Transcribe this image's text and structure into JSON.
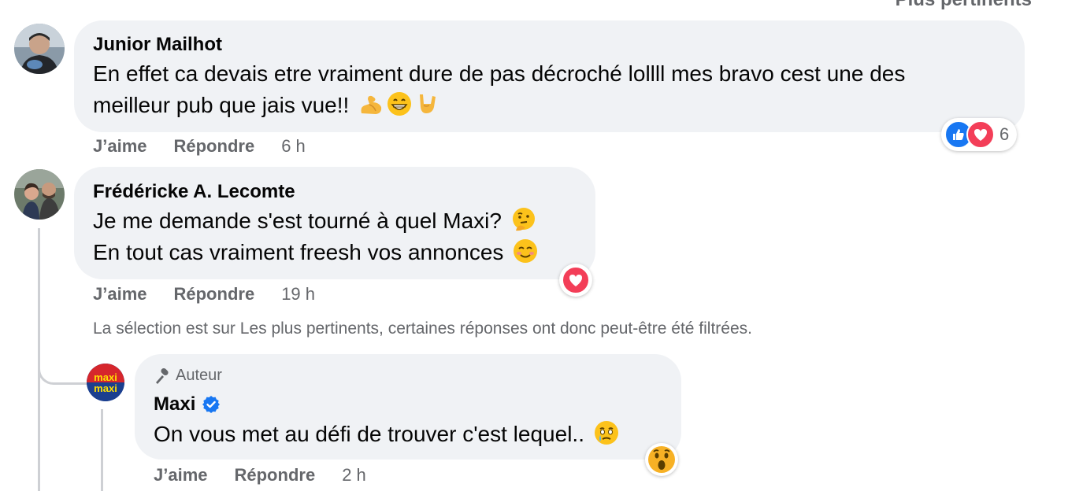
{
  "sort": {
    "label": "Plus pertinents"
  },
  "comments": [
    {
      "author": "Junior Mailhot",
      "text_lines": [
        "En effet ca devais etre vraiment dure de pas décroché lollll mes bravo cest une des",
        "meilleur pub que jais vue!!"
      ],
      "emojis": [
        "flexed-biceps",
        "grinning-face",
        "sign-of-horns"
      ],
      "actions": {
        "like": "J’aime",
        "reply": "Répondre"
      },
      "time": "6 h",
      "reactions": {
        "types": [
          "like",
          "love"
        ],
        "count": "6"
      }
    },
    {
      "author": "Frédéricke A. Lecomte",
      "text_lines": [
        "Je me demande s'est tourné à quel Maxi?",
        "En tout cas vraiment freesh vos annonces"
      ],
      "emojis": [
        "thinking-face",
        "smiling-face"
      ],
      "actions": {
        "like": "J’aime",
        "reply": "Répondre"
      },
      "time": "19 h",
      "reactions": {
        "types": [
          "love"
        ]
      }
    }
  ],
  "filter_note": "La sélection est sur Les plus pertinents, certaines réponses ont donc peut-être été filtrées.",
  "reply": {
    "badge": "Auteur",
    "author": "Maxi",
    "verified": true,
    "avatar_text": [
      "maxi",
      "maxi"
    ],
    "text": "On vous met au défi de trouver c'est lequel..",
    "emoji": "face-holding-back-tears",
    "actions": {
      "like": "J’aime",
      "reply": "Répondre"
    },
    "time": "2 h",
    "reactions": {
      "types": [
        "wow"
      ]
    }
  },
  "colors": {
    "bubble": "#f0f2f5",
    "secondary_text": "#65676b",
    "like_blue": "#1877f2",
    "love_red": "#f33e58",
    "verified_blue": "#1877f2",
    "wow_yellow": "#f7b125"
  }
}
